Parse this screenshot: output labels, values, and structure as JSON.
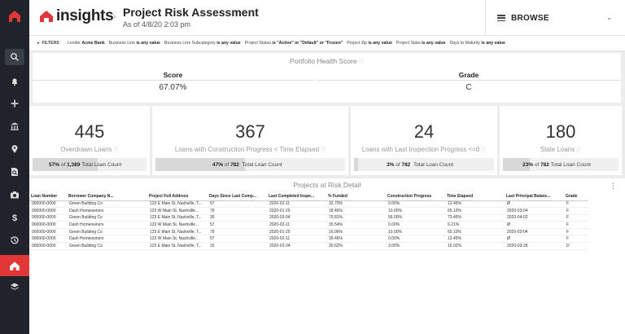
{
  "app": {
    "brand": "insights",
    "title": "Project Risk Assessment",
    "subtitle": "As of 4/8/20 2:03 pm",
    "browse_label": "BROWSE"
  },
  "colors": {
    "accent": "#e23737",
    "rail": "#20232b"
  },
  "rail_icons": [
    "search-icon",
    "bell-icon",
    "plus-icon",
    "bank-icon",
    "location-pin-icon",
    "file-search-icon",
    "camera-icon",
    "dollar-icon",
    "history-icon",
    "home-icon",
    "layers-icon"
  ],
  "filters": {
    "label": "FILTERS",
    "items": [
      {
        "name": "Lender",
        "value": "Acme Bank"
      },
      {
        "name": "Business Line",
        "value": "is any value"
      },
      {
        "name": "Business Line Subcategory",
        "value": "is any value"
      },
      {
        "name": "Project Status",
        "value": "is \"Active\" or \"Default\" or \"Frozen\""
      },
      {
        "name": "Project Zip",
        "value": "is any value"
      },
      {
        "name": "Project State",
        "value": "is any value"
      },
      {
        "name": "Days to Maturity",
        "value": "is any value"
      }
    ]
  },
  "health": {
    "title": "Portfolio Health Score",
    "score_label": "Score",
    "score_value": "67.07%",
    "grade_label": "Grade",
    "grade_value": "C"
  },
  "kpis": [
    {
      "value": "445",
      "label": "Overdrawn Loans",
      "pct": "57%",
      "of": "of",
      "count": "1,389",
      "suffix": "Total Loan Count",
      "fill": 0.57
    },
    {
      "value": "367",
      "label": "Loans with Construction Progress < Time Elapsed",
      "pct": "47%",
      "of": "of",
      "count": "782",
      "suffix": "Total Loan Count",
      "fill": 0.47
    },
    {
      "value": "24",
      "label": "Loans with Last Inspection Progress <=0",
      "pct": "3%",
      "of": "of",
      "count": "782",
      "suffix": "Total Loan Count",
      "fill": 0.03
    },
    {
      "value": "180",
      "label": "Stale Loans",
      "pct": "23%",
      "of": "of",
      "count": "782",
      "suffix": "Total Loan Count",
      "fill": 0.23
    }
  ],
  "risk_table": {
    "title": "Projects at Risk Detail",
    "columns": [
      "Loan Number",
      "Borrower Company N...",
      "Project Full Address",
      "Days Since Last Comp...",
      "Last Completed Inspe...",
      "% Funded",
      "Construction Progress",
      "Time Elapsed",
      "Last Principal Balanc...",
      "Grade"
    ],
    "rows": [
      [
        "000000-0000",
        "Green Building Co",
        "123 E Main St, Nashville, T...",
        "57",
        "2020-02-11",
        "32.70%",
        "0.00%",
        "12.45%",
        "Ø",
        "F"
      ],
      [
        "000000-0000",
        "Dash Homeowners",
        "123 W Main St, Nashville...",
        "79",
        "2020-01-20",
        "18.46%",
        "10.00%",
        "65.10%",
        "2020-03-04",
        "F"
      ],
      [
        "000000-0000",
        "Green Building Co",
        "123 E Main St, Nashville, T...",
        "35",
        "2020-03-04",
        "79.81%",
        "56.00%",
        "73.45%",
        "2020-04-02",
        "F"
      ],
      [
        "000000-0000",
        "Dash Homeowners",
        "123 W Main St, Nashville...",
        "57",
        "2020-02-11",
        "30.54%",
        "0.00%",
        "6.21%",
        "Ø",
        "F"
      ],
      [
        "000000-0000",
        "Green Building Co",
        "123 E Main St, Nashville, T...",
        "79",
        "2020-01-20",
        "16.06%",
        "10.00%",
        "65.10%",
        "2020-03-04",
        "F"
      ],
      [
        "000000-0000",
        "Dash Homeowners",
        "123 W Main St, Nashville...",
        "57",
        "2020-02-11",
        "30.46%",
        "0.00%",
        "12.45%",
        "Ø",
        "F"
      ],
      [
        "000000-0000",
        "Green Building Co",
        "123 E Main St, Nashville, T...",
        "15",
        "2020-03-24",
        "30.62%",
        "3.00%",
        "15.02%",
        "2020-03-28",
        "D"
      ]
    ]
  }
}
